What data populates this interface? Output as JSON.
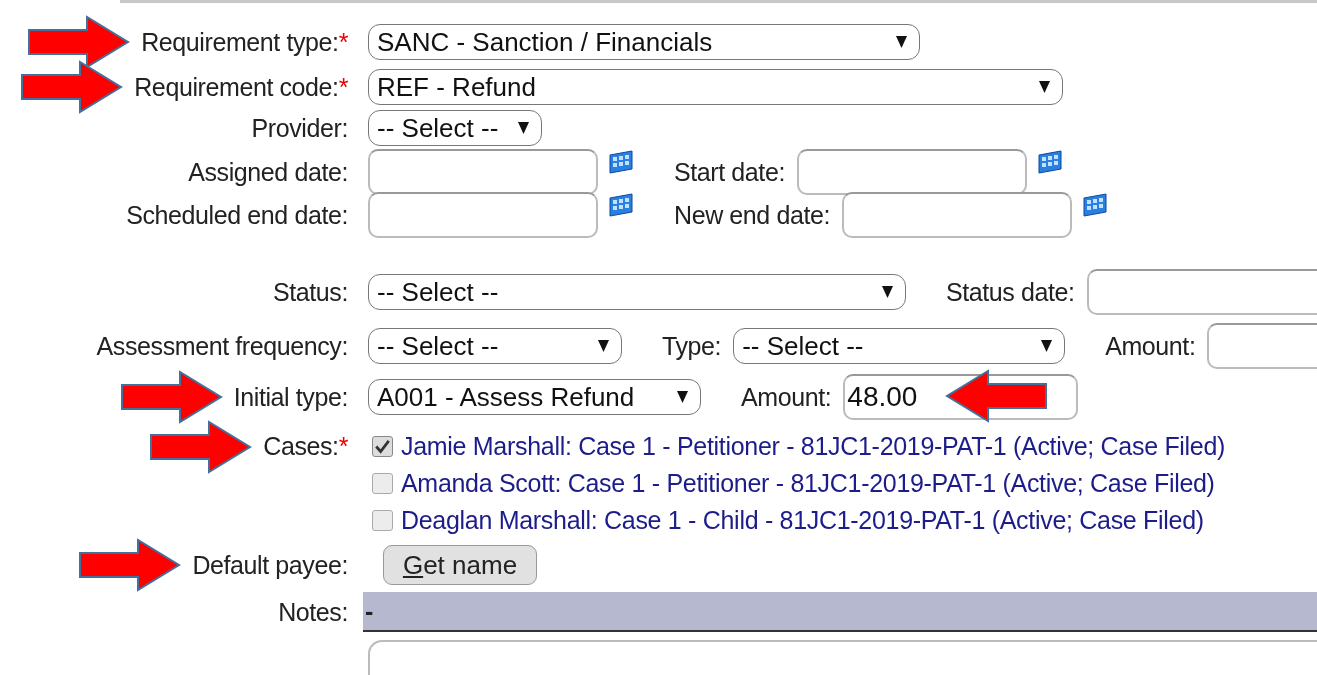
{
  "rows": [
    {
      "label": "Requirement type:",
      "required_mark": "*",
      "marked": true,
      "controls": [
        {
          "kind": "select",
          "value": "SANC - Sanction / Financials"
        }
      ]
    },
    {
      "label": "Requirement code:",
      "required_mark": "*",
      "marked": true,
      "controls": [
        {
          "kind": "select",
          "value": "REF - Refund"
        }
      ]
    },
    {
      "label": "Provider:",
      "marked": false,
      "controls": [
        {
          "kind": "select",
          "value": "-- Select --"
        }
      ]
    },
    {
      "label": "Assigned date:",
      "marked": false,
      "controls": [
        {
          "kind": "date"
        },
        {
          "kind": "label",
          "text": "Start date:"
        },
        {
          "kind": "date"
        }
      ]
    },
    {
      "label": "Scheduled end date:",
      "marked": false,
      "controls": [
        {
          "kind": "date"
        },
        {
          "kind": "label",
          "text": "New end date:"
        },
        {
          "kind": "date"
        }
      ]
    },
    {
      "label": "Status:",
      "marked": false,
      "controls": [
        {
          "kind": "select",
          "value": "-- Select --"
        },
        {
          "kind": "label",
          "text": "Status date:"
        },
        {
          "kind": "text",
          "marked": false
        }
      ]
    },
    {
      "label": "Assessment frequency:",
      "marked": false,
      "controls": [
        {
          "kind": "select",
          "value": "-- Select --"
        },
        {
          "kind": "label",
          "text": "Type:"
        },
        {
          "kind": "select",
          "value": "-- Select --"
        },
        {
          "kind": "label",
          "text": "Amount:"
        },
        {
          "kind": "text",
          "marked": false
        }
      ]
    },
    {
      "label": "Initial type:",
      "marked": true,
      "controls": [
        {
          "kind": "select",
          "value": "A001 - Assess Refund"
        },
        {
          "kind": "label",
          "text": "Amount:"
        },
        {
          "kind": "text",
          "value": "48.00",
          "marked": true
        }
      ]
    },
    {
      "label": "Cases:",
      "required_mark": "*",
      "marked": true,
      "controls": [
        {
          "kind": "checkbox",
          "label": "Jamie Marshall: Case 1 - Petitioner - 81JC1-2019-PAT-1 (Active; Case Filed)",
          "checked": true
        },
        {
          "kind": "checkbox",
          "label": "Amanda Scott: Case 1 - Petitioner - 81JC1-2019-PAT-1 (Active; Case Filed)",
          "checked": false
        },
        {
          "kind": "checkbox",
          "label": "Deaglan Marshall: Case 1 - Child - 81JC1-2019-PAT-1 (Active; Case Filed)",
          "checked": false
        }
      ]
    },
    {
      "label": "Default payee:",
      "marked": true,
      "controls": [
        {
          "kind": "button",
          "label": "Get name"
        }
      ]
    },
    {
      "label": "Notes:",
      "marked": false,
      "controls": [
        {
          "kind": "notes",
          "value": "-"
        }
      ]
    }
  ]
}
